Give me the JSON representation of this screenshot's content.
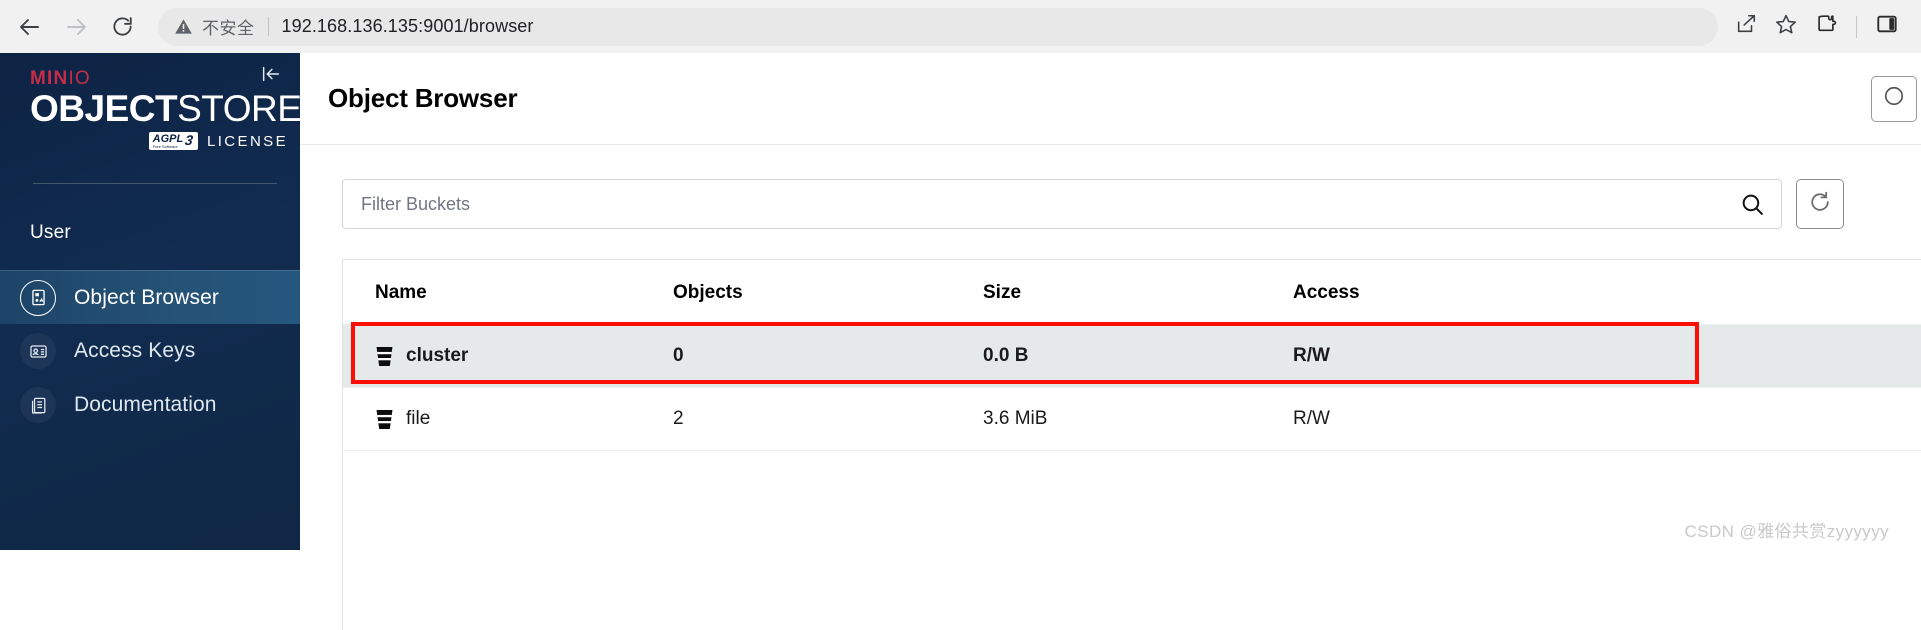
{
  "browser": {
    "back_icon": "back-arrow-icon",
    "forward_icon": "forward-arrow-icon",
    "reload_icon": "reload-icon",
    "security_warning": "不安全",
    "url": "192.168.136.135:9001/browser",
    "share_icon": "share-icon",
    "bookmark_icon": "star-icon",
    "extensions_icon": "puzzle-piece-icon",
    "sidepanel_icon": "side-panel-icon"
  },
  "sidebar": {
    "logo": {
      "brand_bold": "MIN",
      "brand_light": "IO",
      "product_bold": "OBJECT",
      "product_light": "STORE",
      "license_badge": "AGPL",
      "license_badge_sub": "Free Software",
      "license_badge_version": "3",
      "license_text": "LICENSE"
    },
    "collapse_icon": "collapse-sidebar-icon",
    "section_label": "User",
    "items": [
      {
        "label": "Object Browser",
        "icon": "object-browser-icon",
        "active": true
      },
      {
        "label": "Access Keys",
        "icon": "access-keys-icon",
        "active": false
      },
      {
        "label": "Documentation",
        "icon": "documentation-icon",
        "active": false
      }
    ]
  },
  "main": {
    "title": "Object Browser",
    "header_button_icon": "help-icon",
    "filter": {
      "placeholder": "Filter Buckets",
      "value": "",
      "search_icon": "search-icon"
    },
    "refresh_icon": "refresh-icon",
    "table": {
      "columns": [
        "Name",
        "Objects",
        "Size",
        "Access"
      ],
      "rows": [
        {
          "name": "cluster",
          "objects": "0",
          "size": "0.0 B",
          "access": "R/W",
          "highlighted": true
        },
        {
          "name": "file",
          "objects": "2",
          "size": "3.6 MiB",
          "access": "R/W",
          "highlighted": false
        }
      ]
    },
    "annotation_color": "#fc1003"
  },
  "watermark": "CSDN @雅俗共赏zyyyyyy"
}
